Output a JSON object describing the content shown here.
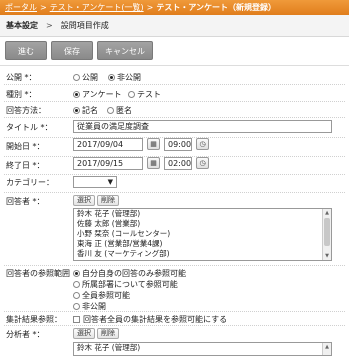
{
  "breadcrumb": {
    "portal": "ポータル",
    "sep": ">",
    "list": "テスト・アンケート(一覧)",
    "current": "テスト・アンケート（新規登録）"
  },
  "subbar": {
    "basic": "基本設定",
    "gt": ">",
    "step": "設問項目作成"
  },
  "buttons": {
    "next": "進む",
    "save": "保存",
    "cancel": "キャンセル"
  },
  "form": {
    "publish": {
      "label": "公開 *：",
      "options": [
        "公開",
        "非公開"
      ],
      "selected": "非公開"
    },
    "kind": {
      "label": "種別 *：",
      "options": [
        "アンケート",
        "テスト"
      ],
      "selected": "アンケート"
    },
    "answer_method": {
      "label": "回答方法：",
      "options": [
        "記名",
        "匿名"
      ],
      "selected": "記名"
    },
    "title": {
      "label": "タイトル *：",
      "value": "従業員の満足度調査"
    },
    "start_date": {
      "label": "開始日 *：",
      "date": "2017/09/04",
      "time": "09:00"
    },
    "end_date": {
      "label": "終了日 *：",
      "date": "2017/09/15",
      "time": "02:00"
    },
    "category": {
      "label": "カテゴリー：",
      "value": ""
    },
    "respondents": {
      "label": "回答者 *：",
      "select_button": "選択",
      "delete_button": "削除",
      "items": [
        "鈴木 花子 (管理部)",
        "佐藤 太郎 (営業部)",
        "小野 栞奈 (コールセンター)",
        "東海 正 (営業部/営業4課)",
        "香川 友 (マーケティング部)"
      ]
    },
    "reference_range": {
      "label": "回答者の参照範囲",
      "options": [
        "自分自身の回答のみ参照可能",
        "所属部署について参照可能",
        "全員参照可能",
        "非公開"
      ],
      "selected": "自分自身の回答のみ参照可能"
    },
    "aggregate": {
      "label": "集計結果参照：",
      "checkbox_label": "回答者全員の集計結果を参照可能にする"
    },
    "analysts": {
      "label": "分析者 *：",
      "select_button": "選択",
      "delete_button": "削除",
      "items": [
        "鈴木 花子 (管理部)"
      ]
    }
  },
  "icons": {
    "calendar": "calendar-icon",
    "clock": "clock-icon",
    "dropdown": "chevron-down-icon"
  },
  "colors": {
    "topbar": "#e8892a",
    "button": "#999999"
  }
}
